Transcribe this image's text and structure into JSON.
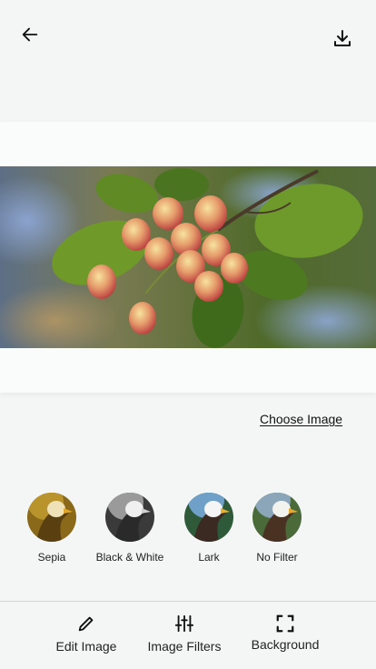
{
  "header": {
    "back_icon": "arrow-left-icon",
    "download_icon": "download-icon"
  },
  "preview": {
    "image_description_icon": "photo-preview"
  },
  "choose_image_label": "Choose Image",
  "filters": [
    {
      "label": "Sepia",
      "icon": "sepia-thumbnail"
    },
    {
      "label": "Black & White",
      "icon": "bw-thumbnail"
    },
    {
      "label": "Lark",
      "icon": "lark-thumbnail"
    },
    {
      "label": "No Filter",
      "icon": "nofilter-thumbnail"
    }
  ],
  "bottom_tabs": [
    {
      "label": "Edit Image",
      "icon": "pencil-icon"
    },
    {
      "label": "Image Filters",
      "icon": "sliders-icon"
    },
    {
      "label": "Background",
      "icon": "expand-icon"
    }
  ],
  "colors": {
    "background": "#f4f6f6",
    "card": "#fafbfb",
    "divider": "#cfd4d6"
  }
}
